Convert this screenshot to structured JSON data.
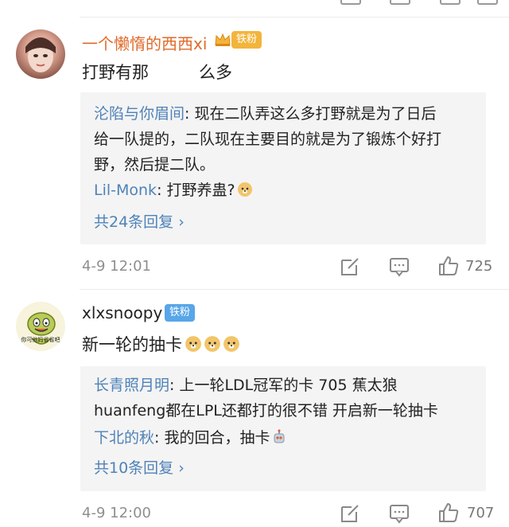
{
  "comments": [
    {
      "username": "一个懒惰的西西xi",
      "badge": "铁粉",
      "text": "打野有那　　　么多",
      "replies": [
        {
          "name": "沦陷与你眉间",
          "sep": ": ",
          "text_lines": [
            "现在二队弄这么多打野就是为了日后",
            "给一队提的，二队现在主要目的就是为了锻炼个好打",
            "野，然后提二队。"
          ]
        },
        {
          "name": "Lil-Monk",
          "sep": ": ",
          "text_lines": [
            "打野养蛊?"
          ]
        }
      ],
      "more_replies": "共24条回复 ›",
      "time": "4-9 12:01",
      "likes": "725"
    },
    {
      "username": "xlxsnoopy",
      "badge": "铁粉",
      "avatar_text": "你可他妈省省吧",
      "text": "新一轮的抽卡",
      "replies": [
        {
          "name": "长青照月明",
          "sep": ": ",
          "text_lines": [
            "上一轮LDL冠军的卡 705 蕉太狼",
            "huanfeng都在LPL还都打的很不错 开启新一轮抽卡"
          ]
        },
        {
          "name": "下北的秋",
          "sep": ": ",
          "text_lines": [
            "我的回合，抽卡"
          ]
        }
      ],
      "more_replies": "共10条回复 ›",
      "time": "4-9 12:00",
      "likes": "707"
    }
  ],
  "colors": {
    "link_blue": "#4f82b8",
    "username_orange": "#e06a2a",
    "badge_gold": "#f3b43c",
    "badge_blue": "#58a6e8",
    "meta_gray": "#8f8f8f",
    "reply_bg": "#f4f4f4"
  },
  "icons": [
    "repost-icon",
    "comment-icon",
    "like-icon",
    "doge-emoji",
    "robot-emoji",
    "crown-icon"
  ]
}
